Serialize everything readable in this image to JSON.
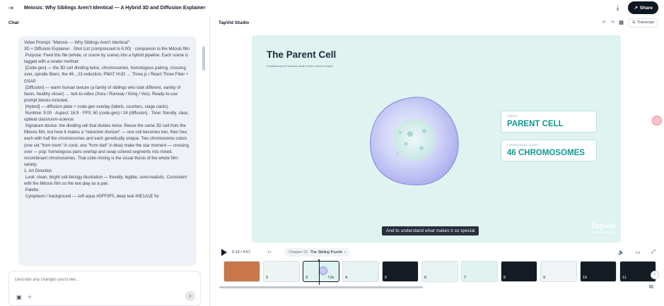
{
  "topbar": {
    "title": "Meiosis: Why Siblings Aren't Identical — A Hybrid 3D and Diffusion Explainer",
    "share_label": "Share",
    "icons": [
      "sidebar-toggle-icon",
      "download-icon",
      "share-icon"
    ]
  },
  "chat": {
    "header": "Chat",
    "message": "Video Prompt: \"Meiosis — Why Siblings Aren't Identical\"\n3D + Diffusion Explainer · Shot List (compressed to 5:00) · companion to the Mitosis film\n Purpose: Feed this file (whole, or scene by scene) into a hybrid pipeline. Each scene is tagged with a render method:\n [Code-gen] — the 3D cell dividing twice, chromosomes, homologous pairing, crossing over, spindle fibers, the 46→23 reduction, PMAT HUD → Three.js / React Three Fiber + GSAP.\n [Diffusion] — warm human texture (a family of siblings who look different, variety of faces, healthy closer) → text-to-video (Sora / Runway / Kling / Veo). Ready-to-use prompt blocks included.\n [Hybrid] — diffusion plate + code-gen overlay (labels, counters, stage cards).\n Runtime: 5:00 · Aspect: 16:9 · FPS: 60 (code-gen) / 24 (diffusion) · Tone: friendly, clear, upbeat classroom-science.\n Signature device: the dividing cell that divides twice. Reuse the same 3D cell from the Mitosis film, but here it makes a \"reduction division\" — one cell becomes two, then four, each with half the chromosomes and each genetically unique. Two chromosome colors (one set \"from mom\" in coral, one \"from dad\" in blue) make the star moment — crossing over — pop: homologous pairs overlap and swap colored segments into mixed, recombinant chromosomes. That color-mixing is the visual thesis of the whole film: variety.\n1. Art Direction\n Look: clean, bright cell-biology illustration — friendly, legible, semi-realistic. Consistent with the Mitosis film so the two play as a pair.\n Palette:\n Cytoplasm / background — soft aqua #DFF3F0, deep teal #0E1A1E for",
    "input_placeholder": "Describe any changes you'd like...",
    "input_tools": [
      "image-icon",
      "magic-wand-icon"
    ]
  },
  "studio": {
    "header": "TapVid Studio",
    "transcript_label": "Transcript",
    "scene": {
      "title": "The Parent Cell",
      "subtitle": "Establishing the baseline state before meiosis begins",
      "card1_label": "TARGET",
      "card1_value": "PARENT CELL",
      "card2_label": "CHROMOSOME COUNT",
      "card2_value": "46 CHROMOSOMES",
      "caption": "And to understand what makes it so special",
      "watermark": "Tapvid",
      "watermark_sub": "Made with tapvid"
    },
    "player": {
      "time": "0:19 / 4:57",
      "speed": "1×",
      "chapter_prefix": "Chapter 01",
      "chapter_name": "The Sibling Puzzle"
    },
    "thumbnails": [
      {
        "num": "",
        "bg": "#c9764a"
      },
      {
        "num": "2",
        "bg": "#eef4f3"
      },
      {
        "num": "3",
        "bg": "#dff3f0",
        "duration": "7.8s"
      },
      {
        "num": "4",
        "bg": "#e6f3f1"
      },
      {
        "num": "5",
        "bg": "#141b22"
      },
      {
        "num": "6",
        "bg": "#e7f3f1"
      },
      {
        "num": "7",
        "bg": "#dff3f0"
      },
      {
        "num": "8",
        "bg": "#141b22"
      },
      {
        "num": "9",
        "bg": "#f1f4f6"
      },
      {
        "num": "10",
        "bg": "#141b22"
      },
      {
        "num": "11",
        "bg": "#141b22"
      }
    ]
  }
}
